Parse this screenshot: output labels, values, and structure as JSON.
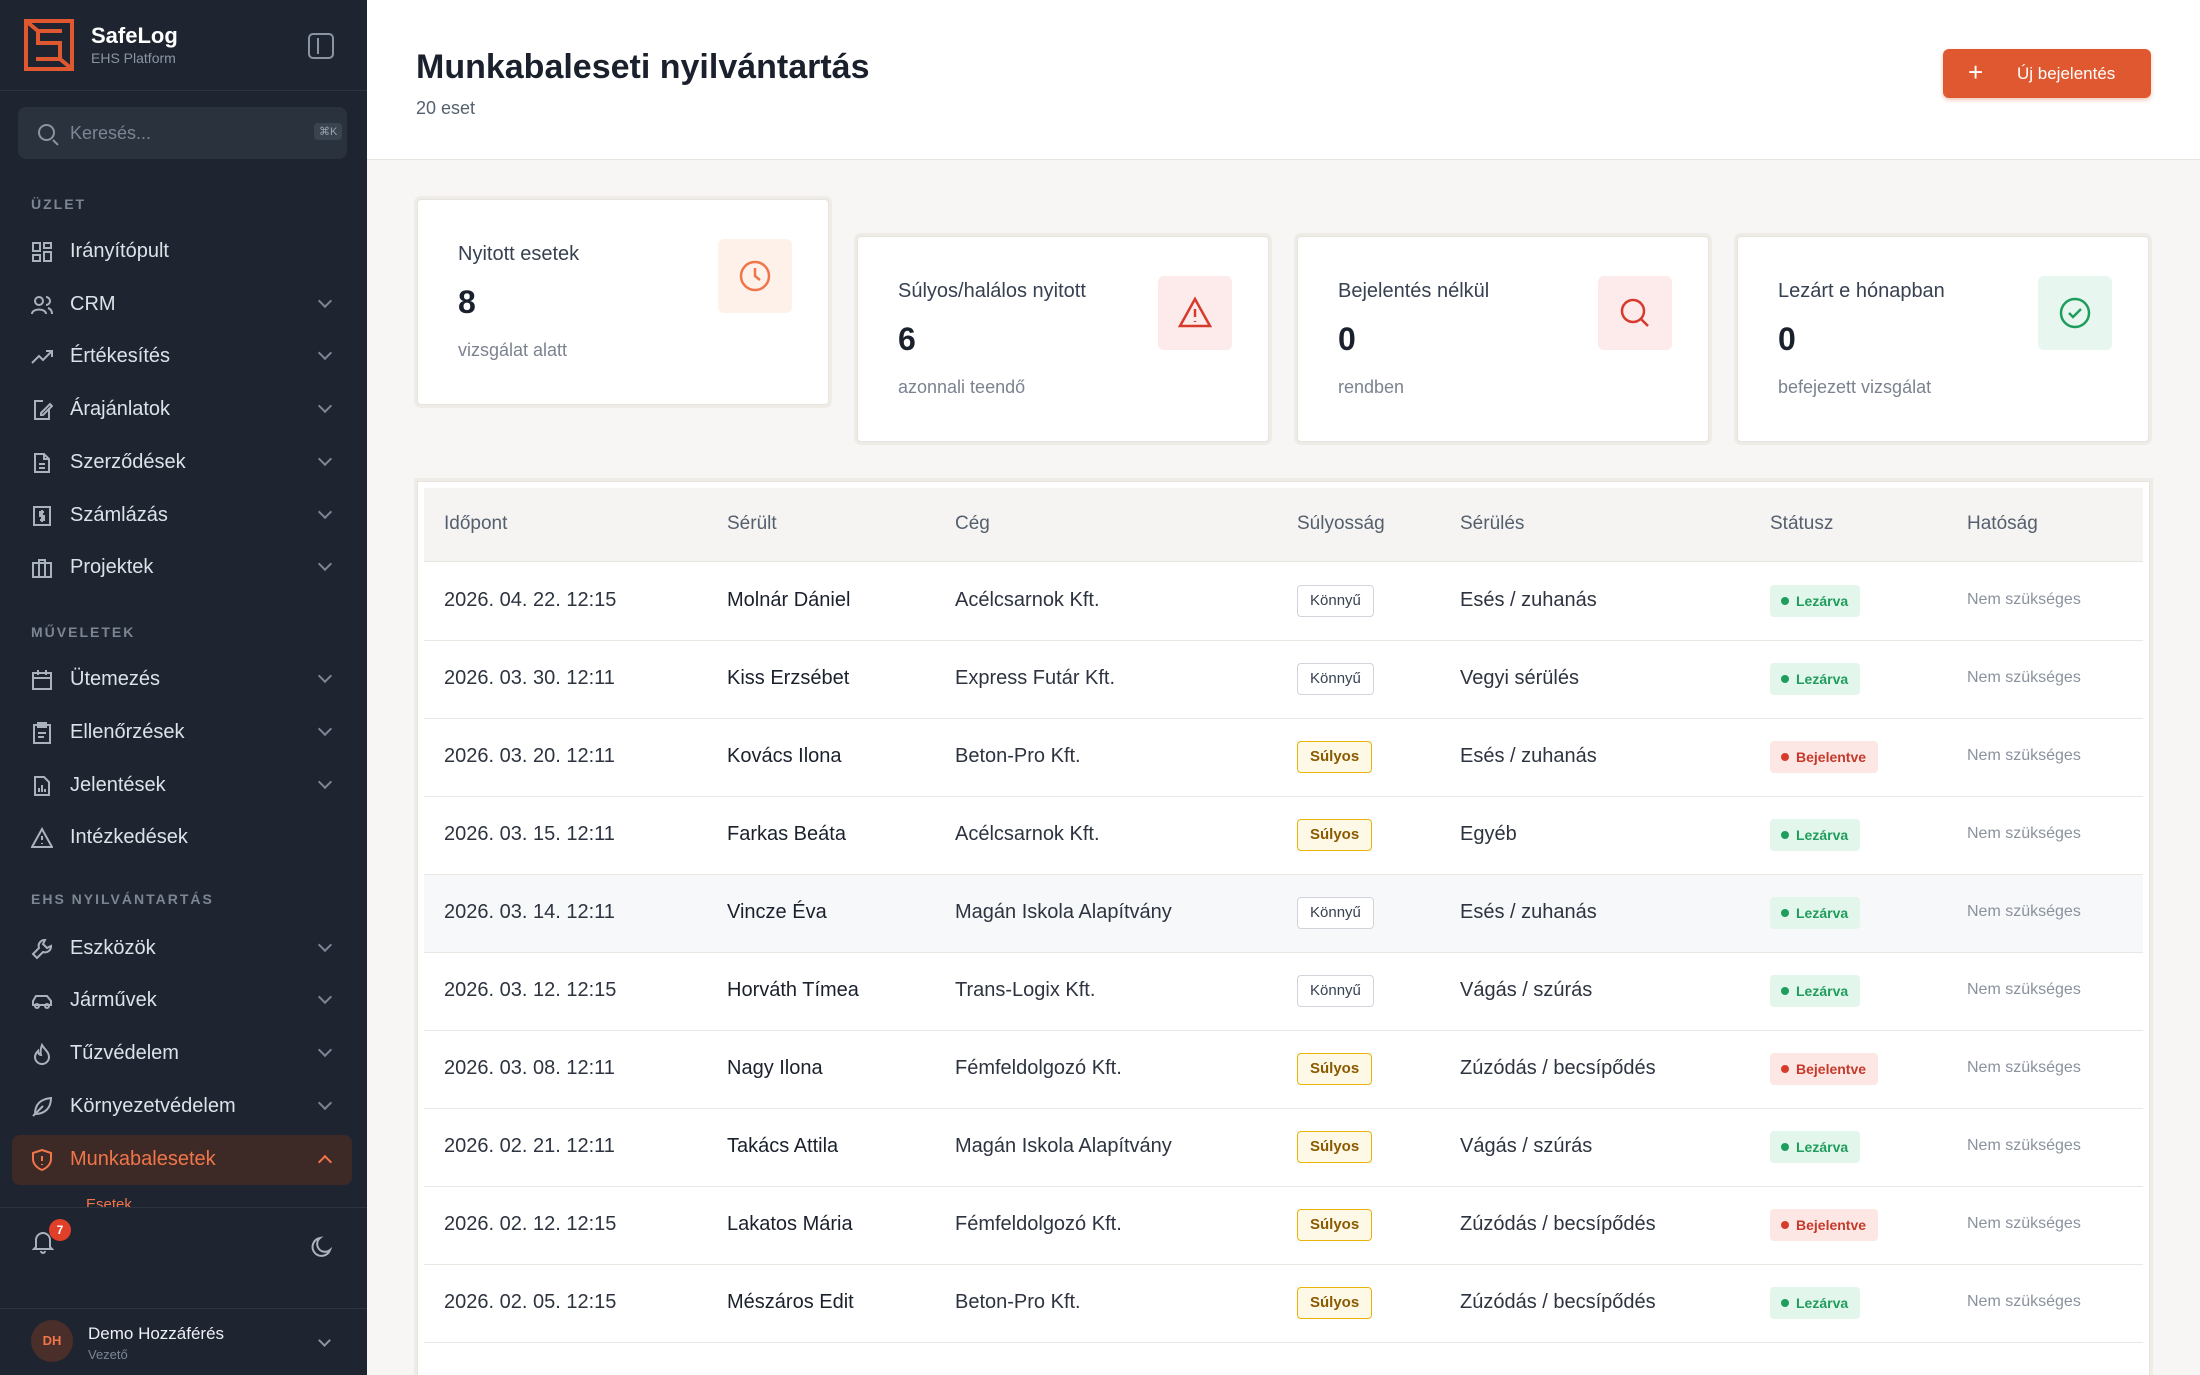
{
  "app": {
    "name": "SafeLog",
    "subtitle": "EHS Platform"
  },
  "search": {
    "placeholder": "Keresés...",
    "shortcut": "⌘K"
  },
  "sidebar": {
    "sections": [
      {
        "label": "ÜZLET"
      },
      {
        "label": "MŰVELETEK"
      },
      {
        "label": "EHS NYILVÁNTARTÁS"
      }
    ],
    "items": [
      {
        "label": "Irányítópult",
        "icon": "dashboard-icon"
      },
      {
        "label": "CRM",
        "icon": "users-icon"
      },
      {
        "label": "Értékesítés",
        "icon": "trend-icon"
      },
      {
        "label": "Árajánlatok",
        "icon": "file-edit-icon"
      },
      {
        "label": "Szerződések",
        "icon": "file-text-icon"
      },
      {
        "label": "Számlázás",
        "icon": "invoice-icon"
      },
      {
        "label": "Projektek",
        "icon": "briefcase-icon"
      },
      {
        "label": "Ütemezés",
        "icon": "calendar-icon"
      },
      {
        "label": "Ellenőrzések",
        "icon": "clipboard-icon"
      },
      {
        "label": "Jelentések",
        "icon": "report-icon"
      },
      {
        "label": "Intézkedések",
        "icon": "alert-icon"
      },
      {
        "label": "Eszközök",
        "icon": "wrench-icon"
      },
      {
        "label": "Járművek",
        "icon": "car-icon"
      },
      {
        "label": "Tűzvédelem",
        "icon": "flame-icon"
      },
      {
        "label": "Környezetvédelem",
        "icon": "leaf-icon"
      },
      {
        "label": "Munkabalesetek",
        "icon": "shield-icon"
      }
    ],
    "sub_item": "Esetek",
    "notifications": "7"
  },
  "user": {
    "initials": "DH",
    "name": "Demo Hozzáférés",
    "role": "Vezető"
  },
  "header": {
    "title": "Munkabaleseti nyilvántartás",
    "subtitle": "20 eset",
    "new_button": "Új bejelentés"
  },
  "cards": [
    {
      "title": "Nyitott esetek",
      "value": "8",
      "sub": "vizsgálat alatt",
      "icon": "clock-icon",
      "color": "#f07549",
      "bg": "#fdf1ea"
    },
    {
      "title": "Súlyos/halálos nyitott",
      "value": "6",
      "sub": "azonnali teendő",
      "icon": "warning-icon",
      "color": "#d63a2a",
      "bg": "#fdeaea"
    },
    {
      "title": "Bejelentés nélkül",
      "value": "0",
      "sub": "rendben",
      "icon": "search-icon",
      "color": "#d63a2a",
      "bg": "#fdeaea"
    },
    {
      "title": "Lezárt e hónapban",
      "value": "0",
      "sub": "befejezett vizsgálat",
      "icon": "check-circle-icon",
      "color": "#1f9d5c",
      "bg": "#e7f6ee"
    }
  ],
  "table": {
    "columns": [
      "Időpont",
      "Sérült",
      "Cég",
      "Súlyosság",
      "Sérülés",
      "Státusz",
      "Hatóság"
    ],
    "rows": [
      [
        "2026. 04. 22. 12:15",
        "Molnár Dániel",
        "Acélcsarnok Kft.",
        "Könnyű",
        "Esés / zuhanás",
        "Lezárva",
        "Nem szükséges"
      ],
      [
        "2026. 03. 30. 12:11",
        "Kiss Erzsébet",
        "Express Futár Kft.",
        "Könnyű",
        "Vegyi sérülés",
        "Lezárva",
        "Nem szükséges"
      ],
      [
        "2026. 03. 20. 12:11",
        "Kovács Ilona",
        "Beton-Pro Kft.",
        "Súlyos",
        "Esés / zuhanás",
        "Bejelentve",
        "Nem szükséges"
      ],
      [
        "2026. 03. 15. 12:11",
        "Farkas Beáta",
        "Acélcsarnok Kft.",
        "Súlyos",
        "Egyéb",
        "Lezárva",
        "Nem szükséges"
      ],
      [
        "2026. 03. 14. 12:11",
        "Vincze Éva",
        "Magán Iskola Alapítvány",
        "Könnyű",
        "Esés / zuhanás",
        "Lezárva",
        "Nem szükséges"
      ],
      [
        "2026. 03. 12. 12:15",
        "Horváth Tímea",
        "Trans-Logix Kft.",
        "Könnyű",
        "Vágás / szúrás",
        "Lezárva",
        "Nem szükséges"
      ],
      [
        "2026. 03. 08. 12:11",
        "Nagy Ilona",
        "Fémfeldolgozó Kft.",
        "Súlyos",
        "Zúzódás / becsípődés",
        "Bejelentve",
        "Nem szükséges"
      ],
      [
        "2026. 02. 21. 12:11",
        "Takács Attila",
        "Magán Iskola Alapítvány",
        "Súlyos",
        "Vágás / szúrás",
        "Lezárva",
        "Nem szükséges"
      ],
      [
        "2026. 02. 12. 12:15",
        "Lakatos Mária",
        "Fémfeldolgozó Kft.",
        "Súlyos",
        "Zúzódás / becsípődés",
        "Bejelentve",
        "Nem szükséges"
      ],
      [
        "2026. 02. 05. 12:15",
        "Mészáros Edit",
        "Beton-Pro Kft.",
        "Súlyos",
        "Zúzódás / becsípődés",
        "Lezárva",
        "Nem szükséges"
      ]
    ]
  },
  "colors": {
    "accent": "#e0582f",
    "sidebar": "#1e2530",
    "success": "#1f9d5c",
    "danger": "#d63a2a"
  }
}
